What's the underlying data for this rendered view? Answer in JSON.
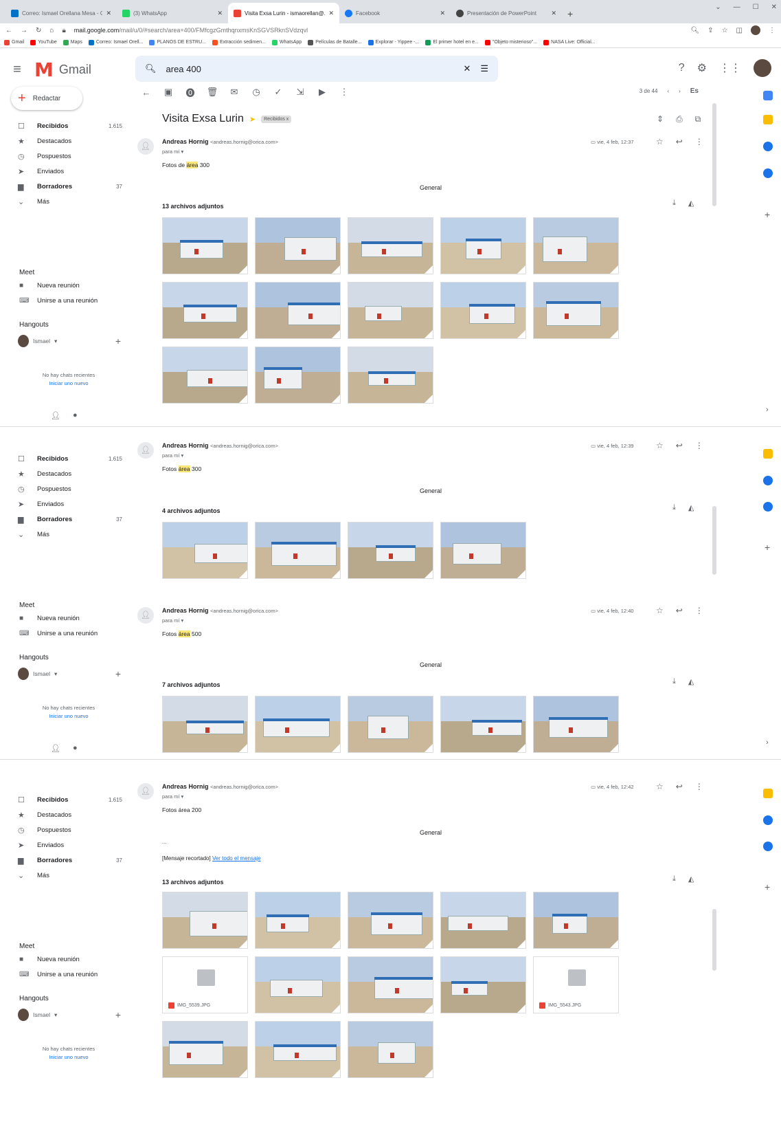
{
  "browser": {
    "tabs": [
      {
        "title": "Correo: Ismael Orellana Mesa - O",
        "color": "#0072c6"
      },
      {
        "title": "(3) WhatsApp",
        "color": "#25d366"
      },
      {
        "title": "Visita Exsa Lurin - ismaorellan@...",
        "color": "#ea4335"
      },
      {
        "title": "Facebook",
        "color": "#1877f2"
      },
      {
        "title": "Presentación de PowerPoint",
        "color": "#444444"
      }
    ],
    "newtab": "+",
    "url_host": "mail.google.com",
    "url_path": "/mail/u/0/#search/area+400/FMfcgzGmthqnxmsKnSGVSRknSVdzqvl",
    "bookmarks": [
      {
        "label": "Gmail",
        "color": "#ea4335"
      },
      {
        "label": "YouTube",
        "color": "#ff0000"
      },
      {
        "label": "Maps",
        "color": "#34a853"
      },
      {
        "label": "Correo: Ismael Orell...",
        "color": "#0072c6"
      },
      {
        "label": "PLANOS DE ESTRU...",
        "color": "#4285f4"
      },
      {
        "label": "Extracción sedimen...",
        "color": "#f4511e"
      },
      {
        "label": "WhatsApp",
        "color": "#25d366"
      },
      {
        "label": "Películas de Batalle...",
        "color": "#555555"
      },
      {
        "label": "Explorar - Yippee -...",
        "color": "#1a73e8"
      },
      {
        "label": "El primer hotel en e...",
        "color": "#0f9d58"
      },
      {
        "label": "\"Objeto misterioso\"...",
        "color": "#ff0000"
      },
      {
        "label": "NASA Live: Official...",
        "color": "#ff0000"
      }
    ]
  },
  "gmail": {
    "brand": "Gmail",
    "search": "area 400",
    "compose": "Redactar",
    "nav": [
      {
        "icon": "inbox-icon",
        "label": "Recibidos",
        "count": "1.615",
        "bold": true
      },
      {
        "icon": "star-icon",
        "label": "Destacados",
        "count": ""
      },
      {
        "icon": "clock-icon",
        "label": "Pospuestos",
        "count": ""
      },
      {
        "icon": "send-icon",
        "label": "Enviados",
        "count": ""
      },
      {
        "icon": "draft-icon",
        "label": "Borradores",
        "count": "37",
        "bold": true
      },
      {
        "icon": "chevron-down-icon",
        "label": "Más",
        "count": ""
      }
    ],
    "meet": {
      "title": "Meet",
      "new_meeting": "Nueva reunión",
      "join": "Unirse a una reunión"
    },
    "hangouts": {
      "title": "Hangouts",
      "user": "Ismael",
      "no_chats": "No hay chats recientes",
      "start": "Iniciar uno nuevo"
    },
    "toolbar": {
      "count": "3 de 44",
      "lang": "Es"
    },
    "subject": "Visita Exsa Lurin",
    "label": "Recibidos x",
    "messages": [
      {
        "from": "Andreas Hornig",
        "email": "<andreas.hornig@orica.com>",
        "to": "para mí",
        "date": "vie, 4 feb, 12:37",
        "body_pre": "Fotos de ",
        "body_hl": "área",
        "body_post": " 300",
        "general": "General",
        "attach": "13 archivos adjuntos"
      },
      {
        "from": "Andreas Hornig",
        "email": "<andreas.hornig@orica.com>",
        "to": "para mí",
        "date": "vie, 4 feb, 12:39",
        "body_pre": "Fotos ",
        "body_hl": "área",
        "body_post": " 300",
        "general": "General",
        "attach": "4 archivos adjuntos"
      },
      {
        "from": "Andreas Hornig",
        "email": "<andreas.hornig@orica.com>",
        "to": "para mí",
        "date": "vie, 4 feb, 12:40",
        "body_pre": "Fotos ",
        "body_hl": "área",
        "body_post": " 500",
        "general": "General",
        "attach": "7 archivos adjuntos"
      },
      {
        "from": "Andreas Hornig",
        "email": "<andreas.hornig@orica.com>",
        "to": "para mí",
        "date": "vie, 4 feb, 12:42",
        "body_pre": "Fotos área 200",
        "body_hl": "",
        "body_post": "",
        "general": "General",
        "ellipsis": "...",
        "trunc": "[Mensaje recortado]",
        "trunc_link": "Ver todo el mensaje",
        "attach": "13 archivos adjuntos",
        "files": [
          "IMG_5539.JPG",
          "IMG_5543.JPG"
        ]
      }
    ]
  }
}
